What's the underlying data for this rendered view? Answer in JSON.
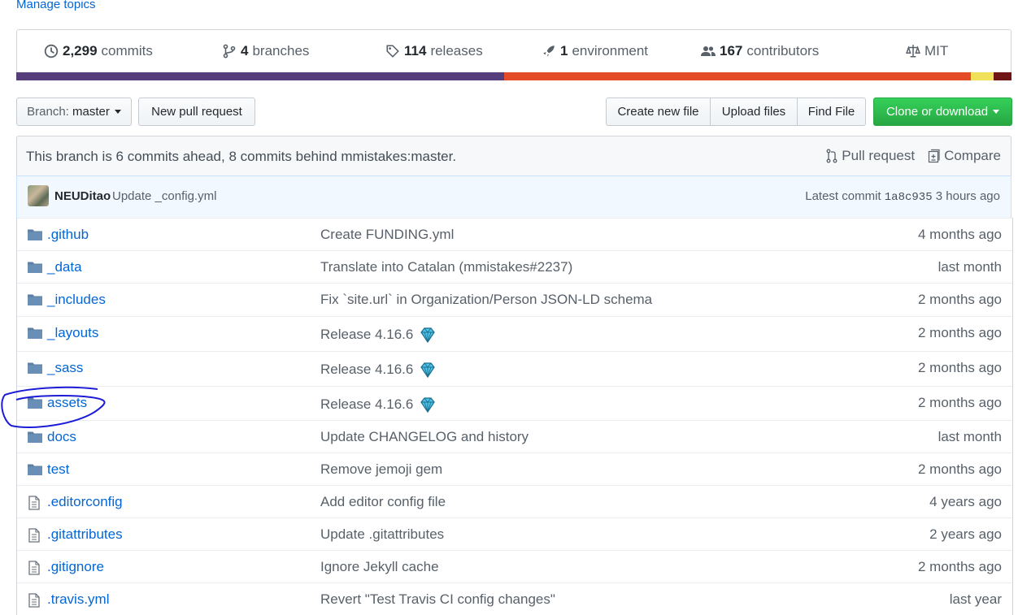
{
  "topics_link": "Manage topics",
  "stats": {
    "commits_count": "2,299",
    "commits_label": "commits",
    "branches_count": "4",
    "branches_label": "branches",
    "releases_count": "114",
    "releases_label": "releases",
    "environment_count": "1",
    "environment_label": "environment",
    "contributors_count": "167",
    "contributors_label": "contributors",
    "license": "MIT"
  },
  "language_bar": [
    {
      "color": "#563d7c",
      "fraction": 0.49
    },
    {
      "color": "#e34c26",
      "fraction": 0.469
    },
    {
      "color": "#f1e05a",
      "fraction": 0.023
    },
    {
      "color": "#701516",
      "fraction": 0.018
    }
  ],
  "toolbar": {
    "branch_prefix": "Branch:",
    "branch_name": "master",
    "new_pull_request": "New pull request",
    "create_new_file": "Create new file",
    "upload_files": "Upload files",
    "find_file": "Find File",
    "clone_or_download": "Clone or download"
  },
  "branch_info": {
    "message": "This branch is 6 commits ahead, 8 commits behind mmistakes:master.",
    "pull_request": "Pull request",
    "compare": "Compare"
  },
  "latest_commit": {
    "author": "NEUDitao",
    "message": "Update _config.yml",
    "latest_label": "Latest commit",
    "sha": "1a8c935",
    "age": "3 hours ago"
  },
  "files": [
    {
      "type": "dir",
      "name": ".github",
      "message": "Create FUNDING.yml",
      "age": "4 months ago",
      "gem": false
    },
    {
      "type": "dir",
      "name": "_data",
      "message": "Translate into Catalan (mmistakes#2237)",
      "age": "last month",
      "gem": false
    },
    {
      "type": "dir",
      "name": "_includes",
      "message": "Fix `site.url` in Organization/Person JSON-LD schema",
      "age": "2 months ago",
      "gem": false
    },
    {
      "type": "dir",
      "name": "_layouts",
      "message": "Release 4.16.6",
      "age": "2 months ago",
      "gem": true
    },
    {
      "type": "dir",
      "name": "_sass",
      "message": "Release 4.16.6",
      "age": "2 months ago",
      "gem": true
    },
    {
      "type": "dir",
      "name": "assets",
      "message": "Release 4.16.6",
      "age": "2 months ago",
      "gem": true
    },
    {
      "type": "dir",
      "name": "docs",
      "message": "Update CHANGELOG and history",
      "age": "last month",
      "gem": false
    },
    {
      "type": "dir",
      "name": "test",
      "message": "Remove jemoji gem",
      "age": "2 months ago",
      "gem": false
    },
    {
      "type": "file",
      "name": ".editorconfig",
      "message": "Add editor config file",
      "age": "4 years ago",
      "gem": false
    },
    {
      "type": "file",
      "name": ".gitattributes",
      "message": "Update .gitattributes",
      "age": "2 years ago",
      "gem": false
    },
    {
      "type": "file",
      "name": ".gitignore",
      "message": "Ignore Jekyll cache",
      "age": "2 months ago",
      "gem": false
    },
    {
      "type": "file",
      "name": ".travis.yml",
      "message": "Revert \"Test Travis CI config changes\"",
      "age": "last year",
      "gem": false
    }
  ],
  "row_heights": [
    40,
    40,
    41,
    43,
    43,
    42,
    40,
    40,
    40,
    40,
    40,
    40
  ]
}
